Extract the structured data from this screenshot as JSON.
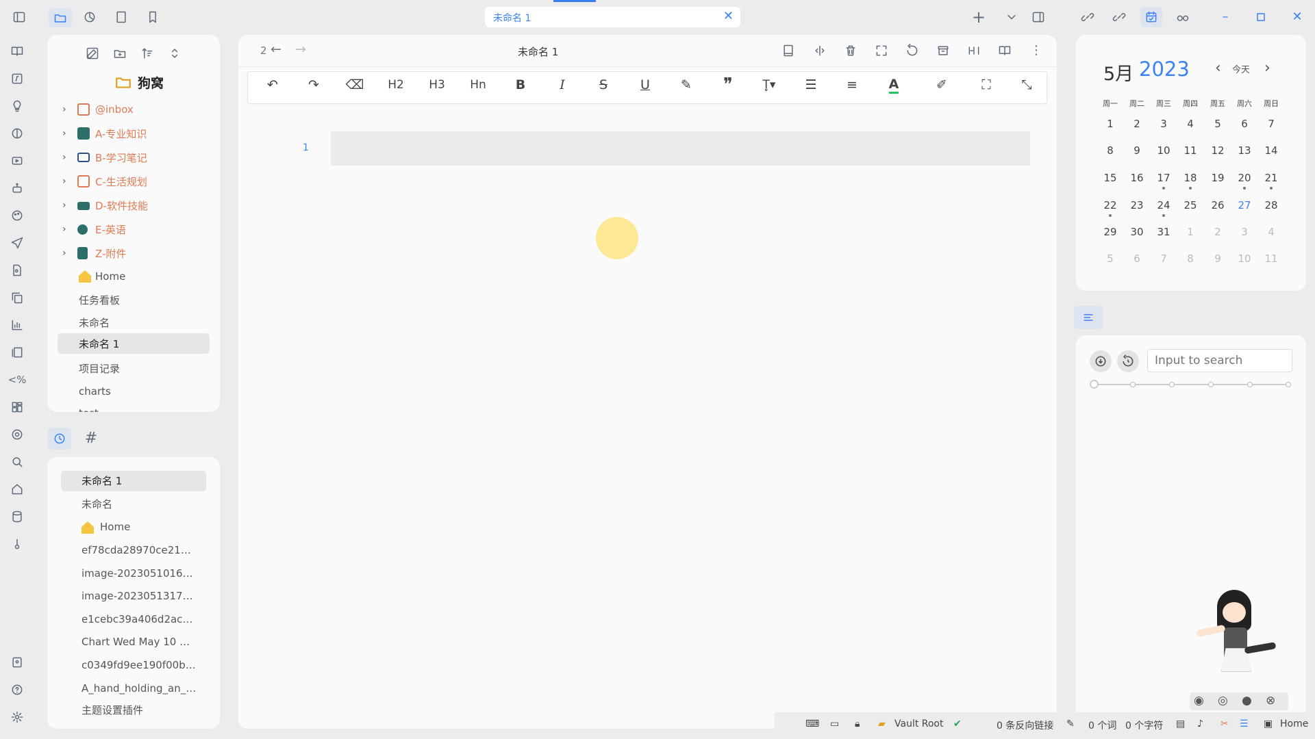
{
  "tab": {
    "title": "未命名 1"
  },
  "vault_title": "狗窝",
  "tree": {
    "folders": [
      {
        "label": "@inbox",
        "color": "#e07a55"
      },
      {
        "label": "A-专业知识",
        "color": "#2c6e6a"
      },
      {
        "label": "B-学习笔记",
        "color": "#2c4e8a"
      },
      {
        "label": "C-生活规划",
        "color": "#e07a55"
      },
      {
        "label": "D-软件技能",
        "color": "#2c6e6a"
      },
      {
        "label": "E-英语",
        "color": "#2c6e6a"
      },
      {
        "label": "Z-附件",
        "color": "#2c6e6a"
      }
    ],
    "files": [
      "Home",
      "任务看板",
      "未命名",
      "未命名 1",
      "项目记录",
      "charts",
      "test"
    ]
  },
  "recent": {
    "items": [
      "未命名 1",
      "未命名",
      "Home",
      "ef78cda28970ce21…",
      "image-2023051016…",
      "image-2023051317…",
      "e1cebc39a406d2ac…",
      "Chart Wed May 10 …",
      "c0349fd9ee190f00b…",
      "A_hand_holding_an_…",
      "主题设置插件"
    ]
  },
  "editor": {
    "breadcrumb_count": "2",
    "title": "未命名 1",
    "line_number": "1",
    "toolbar": {
      "h2": "H2",
      "h3": "H3",
      "hn": "Hn",
      "bold": "B",
      "italic": "I",
      "strike": "S",
      "underline": "U",
      "font_color": "A"
    }
  },
  "calendar": {
    "month": "5月",
    "year": "2023",
    "today_label": "今天",
    "weekdays": [
      "周一",
      "周二",
      "周三",
      "周四",
      "周五",
      "周六",
      "周日"
    ],
    "weeks": [
      [
        "1",
        "2",
        "3",
        "4",
        "5",
        "6",
        "7"
      ],
      [
        "8",
        "9",
        "10",
        "11",
        "12",
        "13",
        "14"
      ],
      [
        "15",
        "16",
        "17",
        "18",
        "19",
        "20",
        "21"
      ],
      [
        "22",
        "23",
        "24",
        "25",
        "26",
        "27",
        "28"
      ],
      [
        "29",
        "30",
        "31",
        "1",
        "2",
        "3",
        "4"
      ],
      [
        "5",
        "6",
        "7",
        "8",
        "9",
        "10",
        "11"
      ]
    ],
    "today": "27"
  },
  "search": {
    "placeholder": "Input to search"
  },
  "status": {
    "vault_root": "Vault Root",
    "backlinks": "0 条反向链接",
    "words": "0 个词",
    "chars": "0 个字符",
    "home": "Home"
  },
  "colors": {
    "accent": "#3b82f6",
    "folder_orange": "#e07a55",
    "teal": "#2c6e6a",
    "cursor_highlight": "#fde68a"
  }
}
